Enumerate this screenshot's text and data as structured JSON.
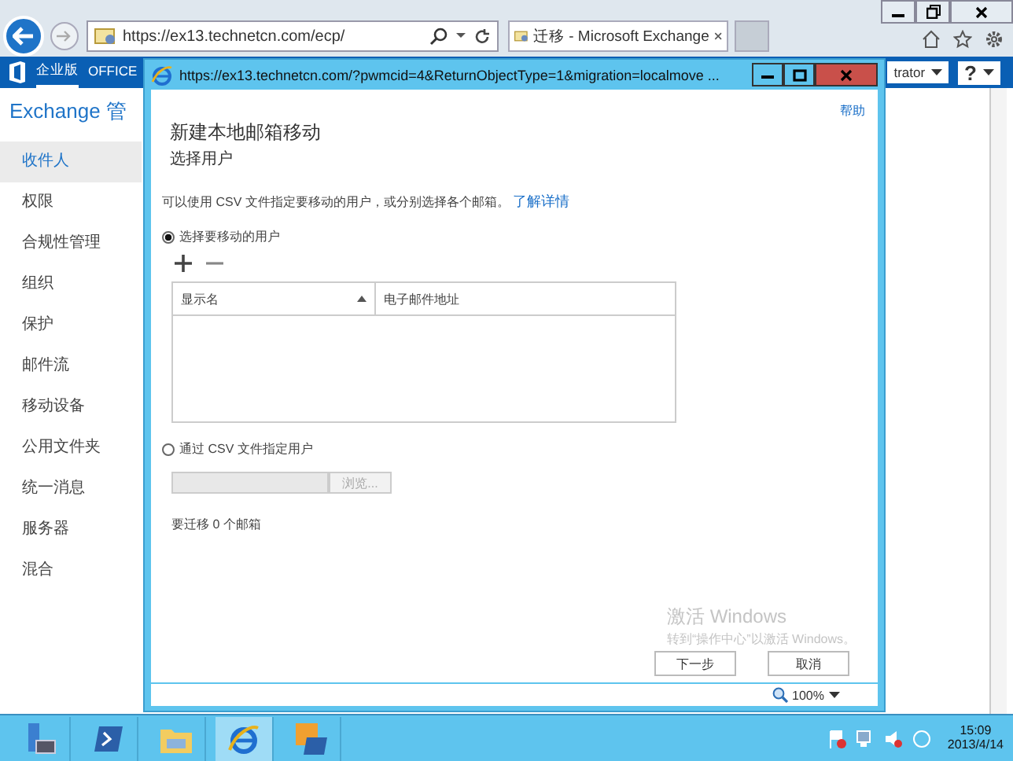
{
  "browser": {
    "address": "https://ex13.technetcn.com/ecp/",
    "tab": {
      "title": "迁移 - Microsoft Exchange",
      "selected": true
    }
  },
  "app_bar": {
    "items": [
      {
        "label": "企业版",
        "selected": true
      },
      {
        "label": "OFFICE",
        "selected": false
      }
    ],
    "user": "trator",
    "help": "?"
  },
  "sidebar": {
    "title": "Exchange 管",
    "items": [
      {
        "label": "收件人",
        "selected": true
      },
      {
        "label": "权限",
        "selected": false
      },
      {
        "label": "合规性管理",
        "selected": false
      },
      {
        "label": "组织",
        "selected": false
      },
      {
        "label": "保护",
        "selected": false
      },
      {
        "label": "邮件流",
        "selected": false
      },
      {
        "label": "移动设备",
        "selected": false
      },
      {
        "label": "公用文件夹",
        "selected": false
      },
      {
        "label": "统一消息",
        "selected": false
      },
      {
        "label": "服务器",
        "selected": false
      },
      {
        "label": "混合",
        "selected": false
      }
    ]
  },
  "dialog": {
    "title": "https://ex13.technetcn.com/?pwmcid=4&ReturnObjectType=1&migration=localmove ...",
    "help": "帮助",
    "heading": "新建本地邮箱移动",
    "subheading": "选择用户",
    "description": "可以使用 CSV 文件指定要移动的用户，或分别选择各个邮箱。",
    "link": "了解详情",
    "options": [
      {
        "label": "选择要移动的用户",
        "selected": true
      },
      {
        "label": "通过 CSV 文件指定用户",
        "selected": false
      }
    ],
    "table": {
      "columns": [
        {
          "label": "显示名",
          "sorted": true
        },
        {
          "label": "电子邮件地址",
          "sorted": false
        }
      ]
    },
    "browse": {
      "label": "浏览...",
      "disabled": true
    },
    "count": "要迁移 0 个邮箱",
    "buttons": [
      {
        "label": "下一步"
      },
      {
        "label": "取消"
      }
    ],
    "zoom": "100%"
  },
  "activation": {
    "title": "激活 Windows",
    "text": "转到“操作中心”以激活 Windows。"
  },
  "taskbar": {
    "items": [
      {
        "kind": "server-manager",
        "selected": false
      },
      {
        "kind": "powershell",
        "selected": false
      },
      {
        "kind": "explorer",
        "selected": false
      },
      {
        "kind": "browser",
        "selected": true
      },
      {
        "kind": "exchange-shell",
        "selected": false
      }
    ],
    "time": "15:09",
    "date": "2013/4/14"
  }
}
